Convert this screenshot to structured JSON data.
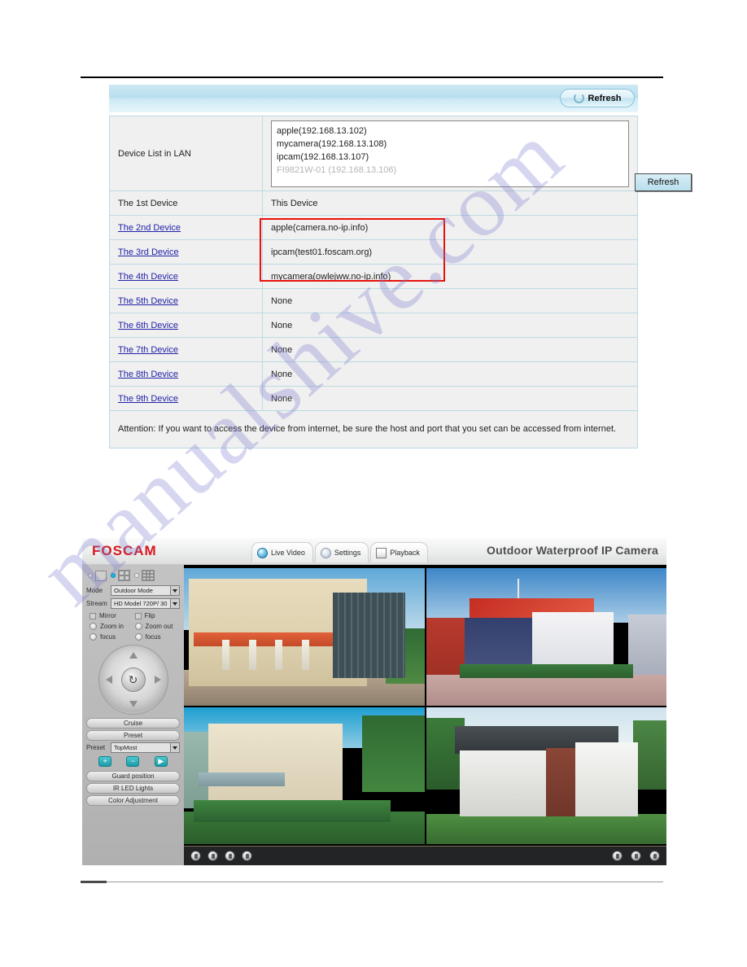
{
  "settings_panel": {
    "header": {
      "refresh_label": "Refresh",
      "refresh_icon": "refresh-circular-arrow-icon"
    },
    "lan_row": {
      "label": "Device List in LAN",
      "devices": [
        "apple(192.168.13.102)",
        "mycamera(192.168.13.108)",
        "ipcam(192.168.13.107)"
      ],
      "dimmed_device": "FI9821W-01 (192.168.13.106)",
      "refresh_label": "Refresh"
    },
    "rows": [
      {
        "label": "The 1st Device",
        "link": false,
        "value": "This Device"
      },
      {
        "label": "The 2nd Device",
        "link": true,
        "value": "apple(camera.no-ip.info)"
      },
      {
        "label": "The 3rd Device",
        "link": true,
        "value": "ipcam(test01.foscam.org)"
      },
      {
        "label": "The 4th Device",
        "link": true,
        "value": "mycamera(owlejww.no-ip.info)"
      },
      {
        "label": "The 5th Device",
        "link": true,
        "value": "None"
      },
      {
        "label": "The 6th Device",
        "link": true,
        "value": "None"
      },
      {
        "label": "The 7th Device",
        "link": true,
        "value": "None"
      },
      {
        "label": "The 8th Device",
        "link": true,
        "value": "None"
      },
      {
        "label": "The 9th Device",
        "link": true,
        "value": "None"
      }
    ],
    "attention": "Attention: If you want to access the device from internet, be sure the host and port that you set can be accessed from internet.",
    "highlight_color": "#e8120c",
    "accent_color": "#bcd9e3"
  },
  "camera_ui": {
    "brand": "FOSCAM",
    "brand_color": "#d71920",
    "product_title": "Outdoor Waterproof IP Camera",
    "tabs": [
      {
        "label": "Live Video",
        "icon": "camera-icon"
      },
      {
        "label": "Settings",
        "icon": "gear-icon"
      },
      {
        "label": "Playback",
        "icon": "playback-icon"
      }
    ],
    "sidebar": {
      "view_modes": [
        {
          "icon": "single-view-icon",
          "selected": false
        },
        {
          "icon": "quad-view-icon",
          "selected": true
        },
        {
          "icon": "nine-view-icon",
          "selected": false
        }
      ],
      "mode_label": "Mode",
      "mode_value": "Outdoor Mode",
      "stream_label": "Stream",
      "stream_value": "HD Model 720P/ 30",
      "mirror_label": "Mirror",
      "flip_label": "Flip",
      "zoom_in_label": "Zoom in",
      "zoom_out_label": "Zoom out",
      "focus_near_label": "focus",
      "focus_far_label": "focus",
      "cruise_label": "Cruise",
      "preset_button_label": "Preset",
      "preset_label": "Preset",
      "preset_value": "TopMost",
      "mini_buttons": [
        {
          "glyph": "+",
          "icon": "add-preset-icon"
        },
        {
          "glyph": "−",
          "icon": "remove-preset-icon"
        },
        {
          "glyph": "▶",
          "icon": "goto-preset-icon"
        }
      ],
      "guard_position_label": "Guard position",
      "ir_led_label": "IR LED Lights",
      "color_adjustment_label": "Color Adjustment"
    },
    "status_bar": {
      "left_icons": [
        "snapshot-icon",
        "record-icon",
        "audio-icon",
        "talk-icon"
      ],
      "right_icons": [
        "stop-icon",
        "alarm-icon",
        "fullscreen-icon"
      ]
    }
  },
  "watermark": {
    "text": "manualshive.com",
    "color": "#7678cd"
  }
}
